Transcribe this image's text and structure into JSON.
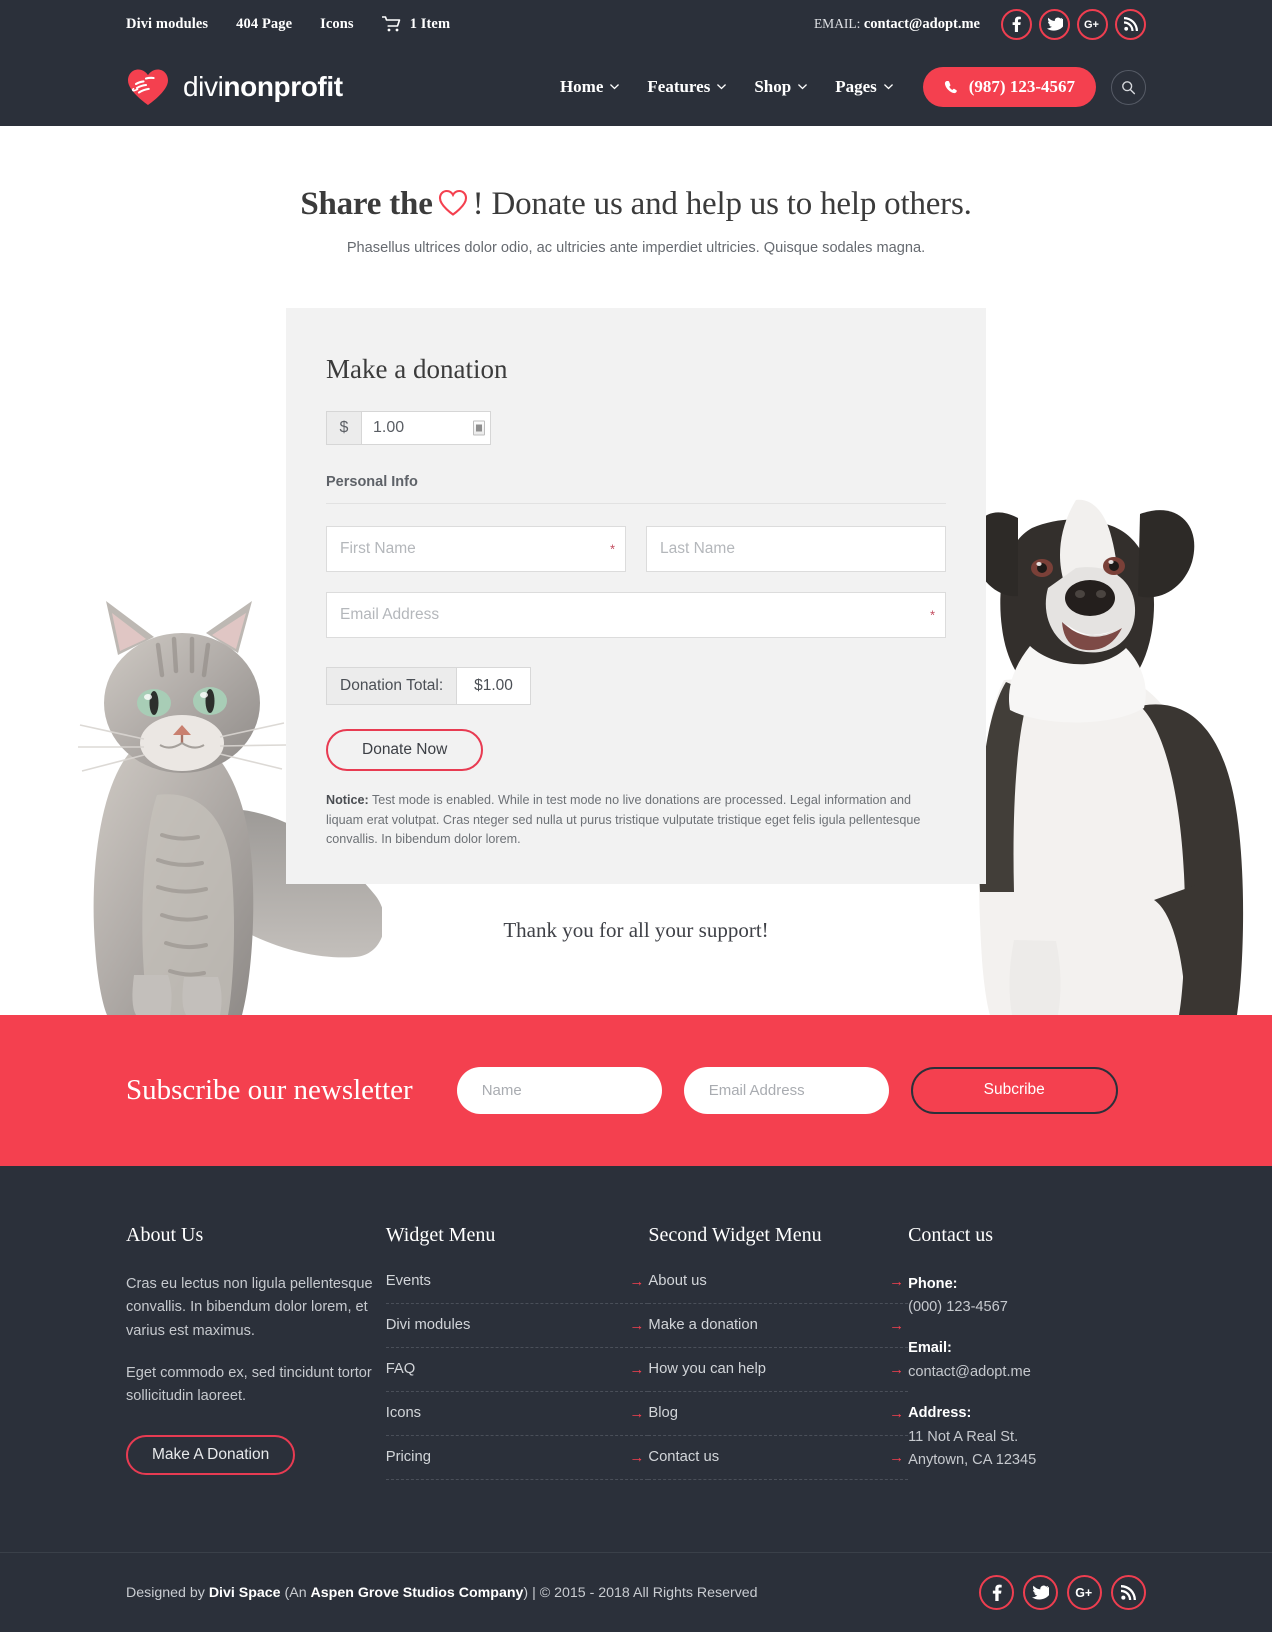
{
  "colors": {
    "brand_red": "#f4404f",
    "dark_navy": "#2b303a",
    "card_grey": "#f2f2f2",
    "accent_outline": "#e83b52"
  },
  "topbar": {
    "links": [
      {
        "label": "Divi modules",
        "name": "topbar-link-divi-modules"
      },
      {
        "label": "404 Page",
        "name": "topbar-link-404-page"
      },
      {
        "label": "Icons",
        "name": "topbar-link-icons"
      }
    ],
    "cart": {
      "icon": "shopping-cart-icon",
      "label": "1 Item"
    },
    "email_prefix": "EMAIL:",
    "email": "contact@adopt.me",
    "social": [
      {
        "icon": "facebook-icon",
        "name": "facebook"
      },
      {
        "icon": "twitter-icon",
        "name": "twitter"
      },
      {
        "icon": "google-plus-icon",
        "name": "google-plus"
      },
      {
        "icon": "rss-icon",
        "name": "rss"
      }
    ]
  },
  "header": {
    "logo": {
      "icon": "heart-hand-logo-icon",
      "text_light": "divi",
      "text_bold": "nonprofit"
    },
    "nav": [
      {
        "label": "Home",
        "has_dropdown": true
      },
      {
        "label": "Features",
        "has_dropdown": true
      },
      {
        "label": "Shop",
        "has_dropdown": true
      },
      {
        "label": "Pages",
        "has_dropdown": true
      }
    ],
    "phone_button": {
      "icon": "phone-icon",
      "label": "(987) 123-4567"
    },
    "search": {
      "icon": "search-icon"
    }
  },
  "hero": {
    "title_bold": "Share the",
    "title_heart": "heart-outline-icon",
    "title_rest": "! Donate us and help us to help others.",
    "subtitle": "Phasellus ultrices dolor odio, ac ultricies ante imperdiet ultricies. Quisque sodales magna.",
    "cat_image": "cat-photo",
    "dog_image": "dog-photo"
  },
  "donation_form": {
    "title": "Make a donation",
    "currency_symbol": "$",
    "amount_value": "1.00",
    "personal_info_label": "Personal Info",
    "fields": [
      {
        "placeholder": "First Name",
        "required": true,
        "name": "first-name-field"
      },
      {
        "placeholder": "Last Name",
        "required": false,
        "name": "last-name-field"
      },
      {
        "placeholder": "Email Address",
        "required": true,
        "name": "email-field"
      }
    ],
    "required_marker": "*",
    "total_label": "Donation Total:",
    "total_value": "$1.00",
    "submit_label": "Donate Now",
    "notice_bold": "Notice:",
    "notice_text": " Test mode is enabled. While in test mode no live donations are processed. Legal information and liquam erat volutpat. Cras nteger sed nulla ut purus tristique vulputate tristique eget felis igula pellentesque convallis. In bibendum dolor lorem."
  },
  "thanks_text": "Thank you for all your support!",
  "newsletter": {
    "title": "Subscribe our newsletter",
    "name_placeholder": "Name",
    "email_placeholder": "Email Address",
    "button_label": "Subcribe"
  },
  "footer": {
    "about": {
      "title": "About Us",
      "paragraph1": "Cras eu lectus non ligula pellentesque convallis. In bibendum dolor lorem, et varius est maximus.",
      "paragraph2": "Eget commodo ex, sed tincidunt tortor sollicitudin laoreet.",
      "button_label": "Make A Donation"
    },
    "widget_menu": {
      "title": "Widget Menu",
      "items": [
        "Events",
        "Divi modules",
        "FAQ",
        "Icons",
        "Pricing"
      ]
    },
    "second_widget_menu": {
      "title": "Second Widget Menu",
      "items": [
        "About us",
        "Make a donation",
        "How you can help",
        "Blog",
        "Contact us"
      ]
    },
    "contact": {
      "title": "Contact us",
      "phone_label": "Phone:",
      "phone_value": "(000) 123-4567",
      "email_label": "Email:",
      "email_value": "contact@adopt.me",
      "address_label": "Address:",
      "address_line1": "11 Not A Real St.",
      "address_line2": "Anytown, CA 12345"
    }
  },
  "bottombar": {
    "credit_pre": "Designed by ",
    "credit_brand": "Divi Space",
    "credit_paren_open": " (An ",
    "credit_brand2": "Aspen Grove Studios Company",
    "credit_post": ") | © 2015 - 2018 All Rights Reserved",
    "social": [
      {
        "icon": "facebook-icon",
        "name": "facebook"
      },
      {
        "icon": "twitter-icon",
        "name": "twitter"
      },
      {
        "icon": "google-plus-icon",
        "name": "google-plus"
      },
      {
        "icon": "rss-icon",
        "name": "rss"
      }
    ]
  }
}
